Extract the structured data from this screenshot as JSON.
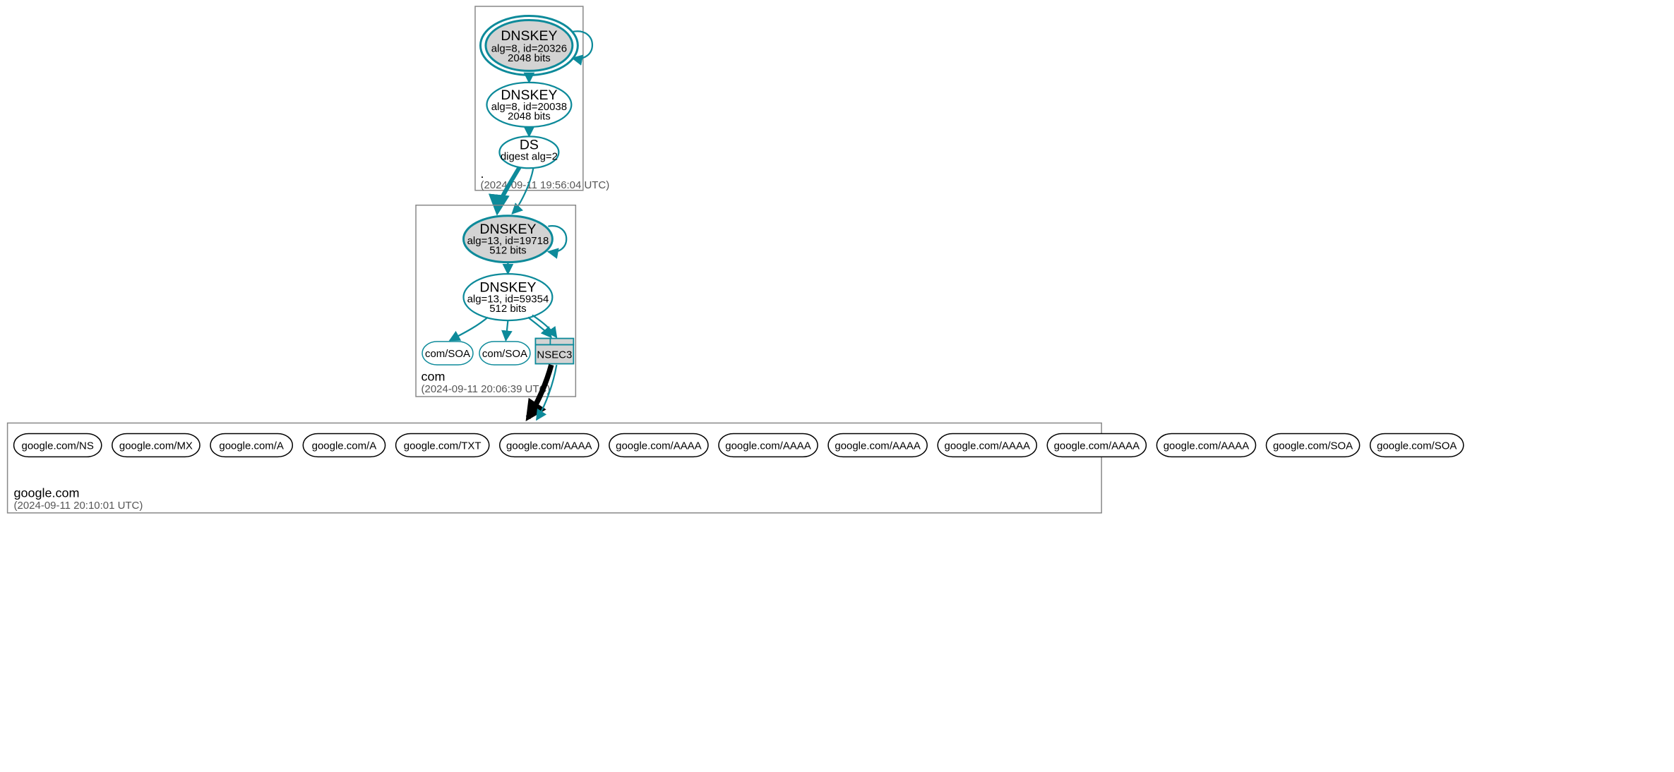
{
  "colors": {
    "teal": "#0d8a9a",
    "grey_fill": "#d3d3d3",
    "box_stroke": "#888888"
  },
  "zones": {
    "root": {
      "label_dot": ".",
      "timestamp": "(2024-09-11 19:56:04 UTC)"
    },
    "com": {
      "label": "com",
      "timestamp": "(2024-09-11 20:06:39 UTC)"
    },
    "google": {
      "label": "google.com",
      "timestamp": "(2024-09-11 20:10:01 UTC)"
    }
  },
  "root": {
    "ksk": {
      "title": "DNSKEY",
      "sub1": "alg=8, id=20326",
      "sub2": "2048 bits"
    },
    "zsk": {
      "title": "DNSKEY",
      "sub1": "alg=8, id=20038",
      "sub2": "2048 bits"
    },
    "ds": {
      "title": "DS",
      "sub": "digest alg=2"
    }
  },
  "com": {
    "ksk": {
      "title": "DNSKEY",
      "sub1": "alg=13, id=19718",
      "sub2": "512 bits"
    },
    "zsk": {
      "title": "DNSKEY",
      "sub1": "alg=13, id=59354",
      "sub2": "512 bits"
    },
    "soa1": "com/SOA",
    "soa2": "com/SOA",
    "nsec3": "NSEC3"
  },
  "google_rrs": [
    "google.com/NS",
    "google.com/MX",
    "google.com/A",
    "google.com/A",
    "google.com/TXT",
    "google.com/AAAA",
    "google.com/AAAA",
    "google.com/AAAA",
    "google.com/AAAA",
    "google.com/AAAA",
    "google.com/AAAA",
    "google.com/AAAA",
    "google.com/SOA",
    "google.com/SOA"
  ]
}
